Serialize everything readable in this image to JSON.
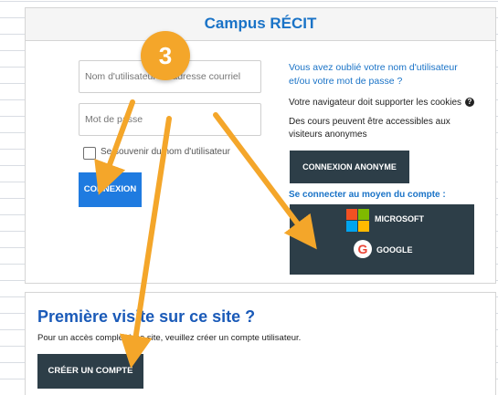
{
  "login_card": {
    "title": "Campus RÉCIT",
    "username_placeholder": "Nom d'utilisateur ou adresse courriel",
    "password_placeholder": "Mot de passe",
    "remember_label": "Se souvenir du nom d'utilisateur",
    "login_button": "CONNEXION",
    "forgot_link": "Vous avez oublié votre nom d'utilisateur et/ou votre mot de passe ?",
    "cookies_text": "Votre navigateur doit supporter les cookies",
    "guest_text": "Des cours peuvent être accessibles aux visiteurs anonymes",
    "guest_button": "CONNEXION ANONYME",
    "oauth_heading": "Se connecter au moyen du compte :",
    "microsoft_label": "MICROSOFT",
    "google_label": "GOOGLE"
  },
  "signup_card": {
    "heading": "Première visite sur ce site ?",
    "text": "Pour un accès complet à ce site, veuillez créer un compte utilisateur.",
    "create_button": "CRÉER UN COMPTE"
  },
  "annotation": {
    "step_number": "3",
    "accent_color": "#f4a62a"
  },
  "colors": {
    "link_blue": "#1a73c7",
    "primary_button": "#1f7be0",
    "dark_button": "#2d3e48"
  }
}
